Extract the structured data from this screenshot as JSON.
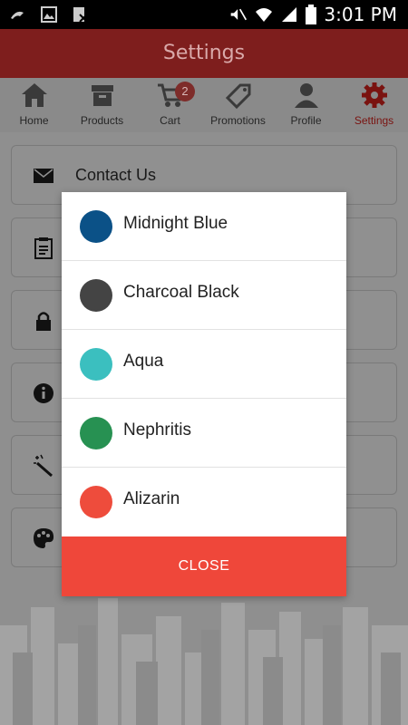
{
  "status_bar": {
    "time": "3:01 PM"
  },
  "header": {
    "title": "Settings"
  },
  "tabs": [
    {
      "label": "Home",
      "icon": "home-icon"
    },
    {
      "label": "Products",
      "icon": "box-icon"
    },
    {
      "label": "Cart",
      "icon": "cart-icon",
      "badge": "2"
    },
    {
      "label": "Promotions",
      "icon": "tag-icon"
    },
    {
      "label": "Profile",
      "icon": "person-icon"
    },
    {
      "label": "Settings",
      "icon": "gear-icon",
      "active": true
    }
  ],
  "settings_list": {
    "first_item_label": "Contact Us"
  },
  "dialog": {
    "options": [
      {
        "name": "Midnight Blue",
        "color": "#0b5187"
      },
      {
        "name": "Charcoal Black",
        "color": "#444444"
      },
      {
        "name": "Aqua",
        "color": "#3bbfbf"
      },
      {
        "name": "Nephritis",
        "color": "#279152"
      },
      {
        "name": "Alizarin",
        "color": "#ee4c3c"
      }
    ],
    "close_label": "CLOSE"
  }
}
